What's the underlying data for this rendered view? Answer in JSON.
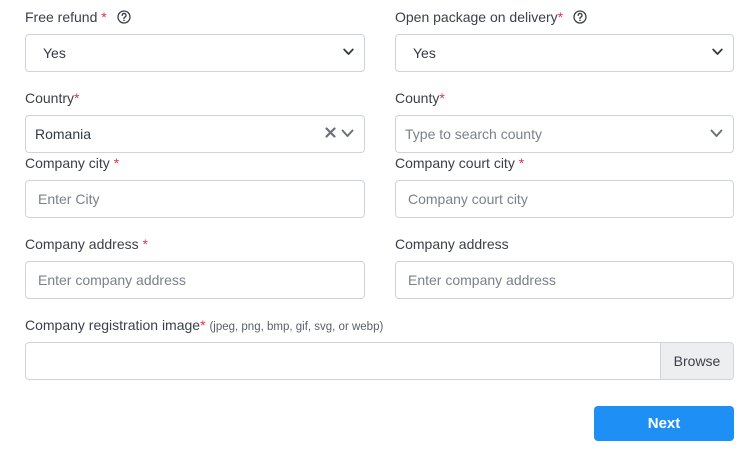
{
  "form": {
    "free_refund": {
      "label": "Free refund",
      "required_mark": "*",
      "value": "Yes"
    },
    "open_package": {
      "label": "Open package on delivery",
      "required_mark": "*",
      "value": "Yes"
    },
    "country": {
      "label": "Country",
      "required_mark": "*",
      "value": "Romania"
    },
    "county": {
      "label": "County",
      "required_mark": "*",
      "placeholder": "Type to search county"
    },
    "company_city": {
      "label": "Company city",
      "required_mark": "*",
      "placeholder": "Enter City"
    },
    "company_court_city": {
      "label": "Company court city",
      "required_mark": "*",
      "placeholder": "Company court city"
    },
    "company_address": {
      "label": "Company address",
      "required_mark": "*",
      "placeholder": "Enter company address"
    },
    "company_address_2": {
      "label": "Company address",
      "placeholder": "Enter company address"
    },
    "registration_image": {
      "label": "Company registration image",
      "required_mark": "*",
      "hint": "(jpeg, png, bmp, gif, svg, or webp)",
      "browse_label": "Browse"
    },
    "next_label": "Next"
  },
  "colors": {
    "accent": "#1e90f5",
    "required": "#e0344b",
    "border": "#cfd4da"
  },
  "icons": {
    "help": "question-circle-icon",
    "chevron": "chevron-down-icon",
    "clear": "close-icon"
  }
}
